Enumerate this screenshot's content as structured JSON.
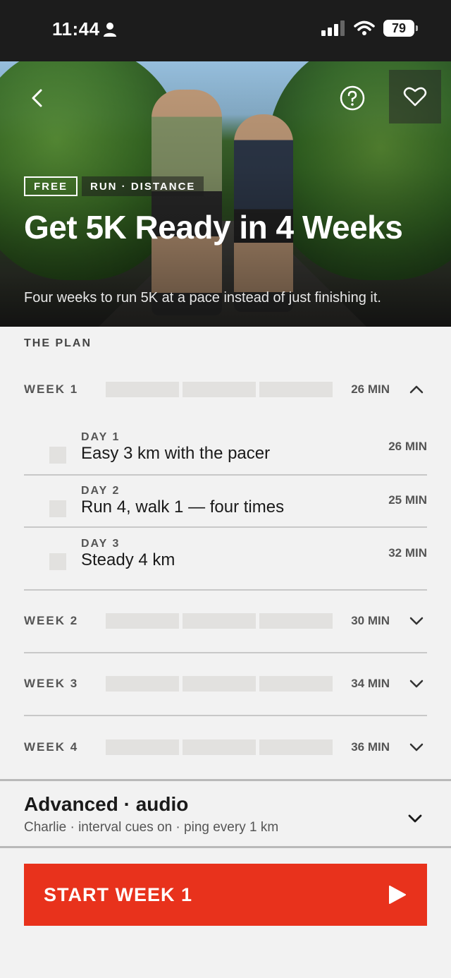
{
  "status_bar": {
    "time": "11:44",
    "battery": "79"
  },
  "hero": {
    "tags": [
      "FREE",
      "RUN · DISTANCE"
    ],
    "title": "Get 5K Ready in 4 Weeks",
    "subtitle": "Four weeks to run 5K at a pace instead of just finishing it."
  },
  "plan": {
    "label": "THE PLAN",
    "weeks": [
      {
        "label": "WEEK 1",
        "duration": "26 MIN",
        "expanded": true,
        "days": [
          {
            "label": "DAY 1",
            "title": "Easy 3 km with the pacer",
            "duration": "26 MIN"
          },
          {
            "label": "DAY 2",
            "title": "Run 4, walk 1 — four times",
            "duration": "25 MIN"
          },
          {
            "label": "DAY 3",
            "title": "Steady 4 km",
            "duration": "32 MIN"
          }
        ]
      },
      {
        "label": "WEEK 2",
        "duration": "30 MIN",
        "expanded": false
      },
      {
        "label": "WEEK 3",
        "duration": "34 MIN",
        "expanded": false
      },
      {
        "label": "WEEK 4",
        "duration": "36 MIN",
        "expanded": false
      }
    ]
  },
  "advanced": {
    "title": "Advanced · audio",
    "subtitle": "Charlie · interval cues on · ping every 1 km"
  },
  "start_button": {
    "label": "START WEEK 1"
  },
  "colors": {
    "accent": "#e8321c",
    "background": "#f2f2f2",
    "status_bar": "#1c1c1c"
  },
  "icons": [
    "person-icon",
    "signal-icon",
    "wifi-icon",
    "battery-icon",
    "back-icon",
    "help-icon",
    "heart-icon",
    "chevron-up-icon",
    "chevron-down-icon",
    "play-icon"
  ]
}
